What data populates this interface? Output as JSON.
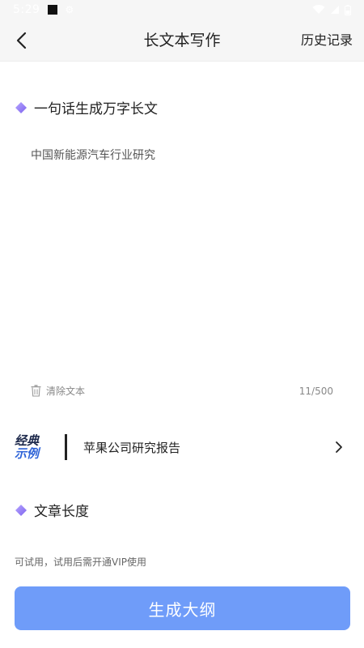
{
  "status_bar": {
    "time": "5:29"
  },
  "header": {
    "title": "长文本写作",
    "history_label": "历史记录"
  },
  "prompt_section": {
    "title": "一句话生成万字长文",
    "input_value": "中国新能源汽车行业研究",
    "clear_label": "清除文本",
    "char_count": "11/500"
  },
  "example": {
    "badge_top": "经典",
    "badge_bottom": "示例",
    "label": "苹果公司研究报告"
  },
  "length_section": {
    "title": "文章长度"
  },
  "trial_note": "可试用，试用后需开通VIP使用",
  "generate_button_label": "生成大纲",
  "colors": {
    "accent": "#6f9cf9",
    "diamond": "#8f7cf0"
  }
}
